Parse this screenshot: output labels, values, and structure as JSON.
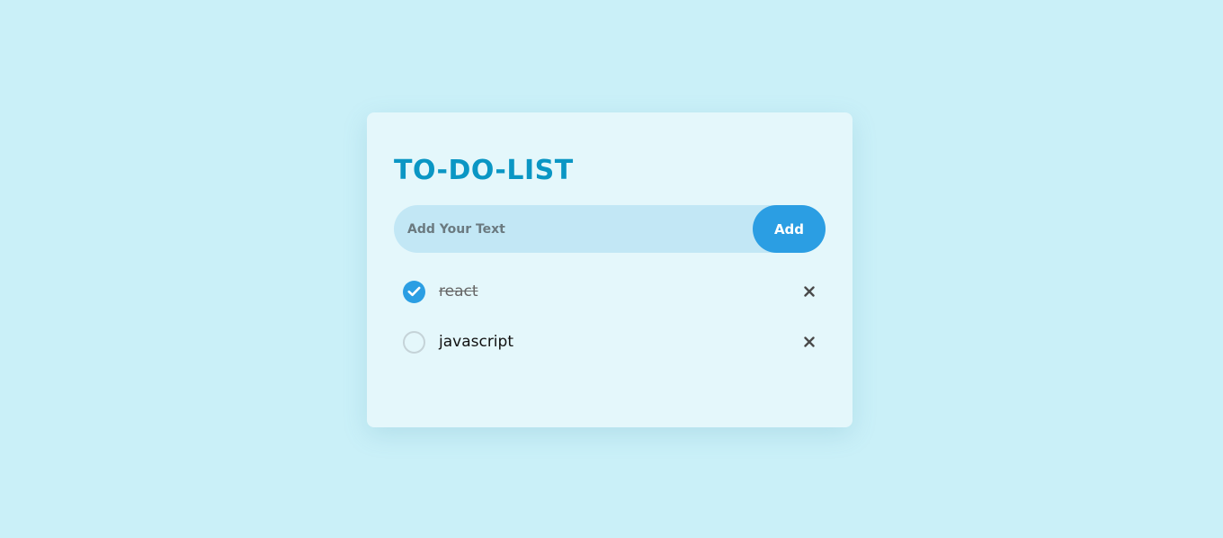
{
  "app": {
    "title": "TO-DO-LIST"
  },
  "input": {
    "value": "",
    "placeholder": "Add Your Text"
  },
  "add_button": {
    "label": "Add"
  },
  "todos": [
    {
      "label": "react",
      "done": true,
      "checkbox_icon": "check-circle-icon",
      "delete_icon": "close-icon"
    },
    {
      "label": "javascript",
      "done": false,
      "checkbox_icon": "empty-circle-icon",
      "delete_icon": "close-icon"
    }
  ],
  "colors": {
    "background": "#caf0f8",
    "card": "#e4f7fb",
    "accent": "#2b9ee3",
    "title": "#0a96c4",
    "input_bg": "#c2e7f5"
  }
}
